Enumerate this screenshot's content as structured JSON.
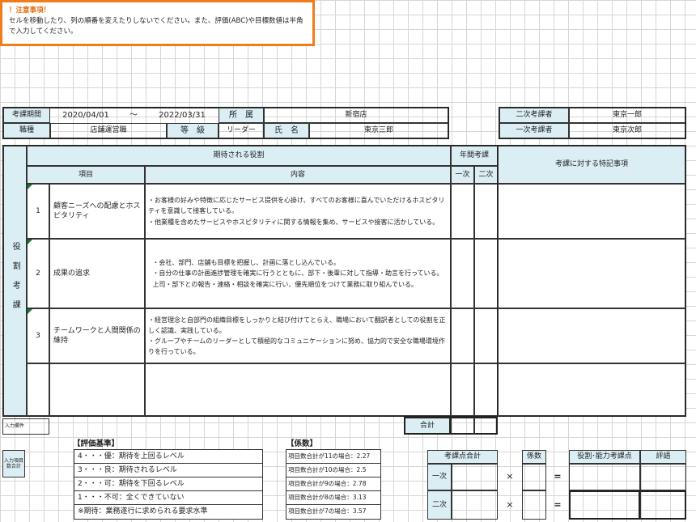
{
  "notice": {
    "title": "！注意事項！",
    "line1": "セルを移動したり、列の順番を変えたりしないでください。また、評価(ABC)や目標数値は半角",
    "line2": "で入力してください。"
  },
  "header": {
    "period_label": "考課期間",
    "period_start": "2020/04/01",
    "period_sep": "～",
    "period_end": "2022/03/31",
    "affiliation_label": "所　属",
    "affiliation_value": "新宿店",
    "job_label": "職種",
    "job_value": "店舗運営職",
    "grade_label": "等　級",
    "grade_value": "リーダー",
    "name_label": "氏　名",
    "name_value": "東京三郎",
    "secondary_evaluator_label": "二次考課者",
    "secondary_evaluator_value": "東京一郎",
    "primary_evaluator_label": "一次考課者",
    "primary_evaluator_value": "東京次郎"
  },
  "main": {
    "side_label": "役割考課",
    "expected_roles_label": "期待される役割",
    "annual_eval_label": "年間考課",
    "first_label": "一次",
    "second_label": "二次",
    "notes_label": "考課に対する特記事項",
    "item_col_label": "項目",
    "content_col_label": "内容",
    "rows": [
      {
        "num": "1",
        "item": "顧客ニーズへの配慮とホスピタリティ",
        "content": "・お客様の好みや特徴に応じたサービス提供を心掛け、すべてのお客様に喜んでいただけるホスピタリティを意識して接客している。\n・他業種を含めたサービスやホスピタリティに関する情報を集め、サービスや接客に活かしている。"
      },
      {
        "num": "2",
        "item": "成果の追求",
        "content": "・会社、部門、店舗も目標を把握し、計画に落とし込んでいる。\n・自分の仕事の計画進捗管理を確実に行うとともに、部下・後輩に対して指導・助言を行っている。\n上司・部下との報告・連絡・相談を確実に行い、優先順位をつけて業務に取り組んでいる。"
      },
      {
        "num": "3",
        "item": "チームワークと人間関係の維持",
        "content": "・経営理念と自部門の組織目標をしっかりと結び付けてとらえ、職場において翻訳者としての役割を正しく認識、実践している。\n・グループやチームのリーダーとして積極的なコミュニケーションに努め、協力的で安全な職場環境作りを行っている。"
      }
    ],
    "total_label": "合計",
    "input_field_label": "入力欄件"
  },
  "criteria": {
    "title": "【評価基準】",
    "items": [
      "4・・・優：期待を上回るレベル",
      "3・・・良：期待されるレベル",
      "2・・・可：期待を下回るレベル",
      "1・・・不可：全くできていない",
      "※期待：業務遂行に求められる要求水準"
    ],
    "side_label": "入力項目数合計"
  },
  "coefficient": {
    "title": "【係数】",
    "items": [
      "項目数合計が11の場合：2.27",
      "項目数合計が10の場合：2.5",
      "項目数合計が9の場合：2.78",
      "項目数合計が8の場合：3.13",
      "項目数合計が7の場合：3.57"
    ]
  },
  "score": {
    "total_points_label": "考課点合計",
    "coefficient_label": "係数",
    "role_ability_label": "役割･能力考課点",
    "rating_label": "評語",
    "first_label": "一次",
    "second_label": "二次",
    "times": "×",
    "equals": "="
  },
  "colors": {
    "header_fill": "#dbeef4",
    "notice_border": "#f07c1a",
    "notice_title": "#e36c0a",
    "gridline": "#d6d6d6",
    "marker": "#1e7a3a"
  }
}
